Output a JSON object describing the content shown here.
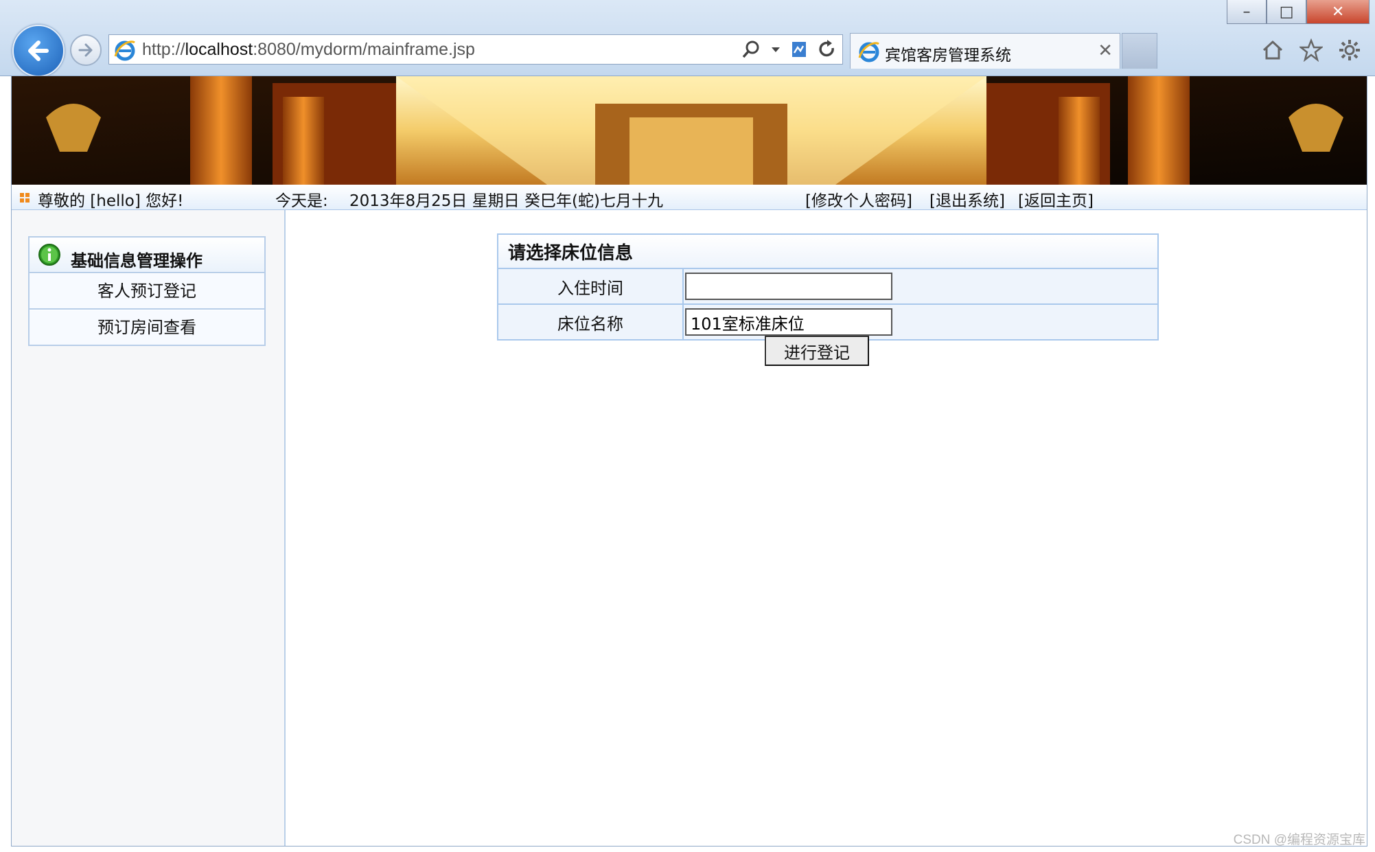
{
  "browser": {
    "url_prefix": "http://",
    "url_host": "localhost",
    "url_rest": ":8080/mydorm/mainframe.jsp",
    "tab_title": "宾馆客房管理系统",
    "window_controls": [
      "–",
      "□",
      "✕"
    ]
  },
  "infobar": {
    "greeting": "尊敬的 [hello] 您好!",
    "date_label": "今天是:",
    "date_value": "2013年8月25日 星期日 癸巳年(蛇)七月十九",
    "links": [
      "[修改个人密码]",
      "[退出系统]",
      "[返回主页]"
    ]
  },
  "sidebar": {
    "title": "基础信息管理操作",
    "items": [
      "客人预订登记",
      "预订房间查看"
    ]
  },
  "form": {
    "caption": "请选择床位信息",
    "checkin_label": "入住时间",
    "checkin_value": "",
    "bed_label": "床位名称",
    "bed_value": "101室标准床位",
    "submit_label": "进行登记"
  },
  "watermark": "CSDN @编程资源宝库"
}
